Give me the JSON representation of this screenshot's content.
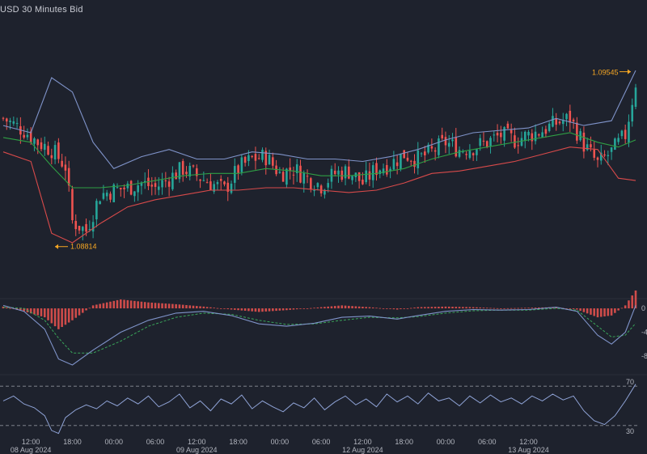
{
  "title": "USD  30 Minutes Bid",
  "colors": {
    "background": "#1e222d",
    "up": "#26a69a",
    "down": "#ef5350",
    "bb_upper": "#7f93c9",
    "bb_middle": "#2f9e44",
    "bb_lower": "#d84a4a",
    "marker": "#f5a623",
    "macd_line": "#7f93c9",
    "signal_line": "#3aa55a",
    "histogram": "#ef5350",
    "rsi_line": "#8fa3d6",
    "level_line": "#8c8f99",
    "axis_text": "#b2b5be"
  },
  "chart_data": [
    {
      "type": "candlestick",
      "name": "price",
      "ylim": [
        1.086,
        1.0975
      ],
      "max_marker": {
        "label": "1.09545",
        "value": 1.09545
      },
      "min_marker": {
        "label": "1.08814",
        "value": 1.08814
      },
      "indicators": [
        "bollinger_upper",
        "bollinger_middle",
        "bollinger_lower"
      ],
      "close_path": [
        [
          0,
          1.0935
        ],
        [
          6,
          1.093
        ],
        [
          10,
          1.0925
        ],
        [
          14,
          1.0922
        ],
        [
          18,
          1.0915
        ],
        [
          20,
          1.0892
        ],
        [
          24,
          1.0888
        ],
        [
          28,
          1.0903
        ],
        [
          32,
          1.0905
        ],
        [
          36,
          1.0906
        ],
        [
          40,
          1.0908
        ],
        [
          44,
          1.0906
        ],
        [
          48,
          1.091
        ],
        [
          52,
          1.0914
        ],
        [
          56,
          1.0911
        ],
        [
          60,
          1.0908
        ],
        [
          64,
          1.0905
        ],
        [
          68,
          1.0914
        ],
        [
          72,
          1.0918
        ],
        [
          76,
          1.0919
        ],
        [
          80,
          1.0912
        ],
        [
          84,
          1.0914
        ],
        [
          88,
          1.091
        ],
        [
          92,
          1.0907
        ],
        [
          96,
          1.0912
        ],
        [
          100,
          1.0913
        ],
        [
          104,
          1.0908
        ],
        [
          108,
          1.0914
        ],
        [
          112,
          1.0916
        ],
        [
          116,
          1.092
        ],
        [
          120,
          1.0918
        ],
        [
          124,
          1.0921
        ],
        [
          128,
          1.0925
        ],
        [
          132,
          1.0922
        ],
        [
          136,
          1.0923
        ],
        [
          140,
          1.0925
        ],
        [
          144,
          1.0928
        ],
        [
          148,
          1.0926
        ],
        [
          152,
          1.0928
        ],
        [
          156,
          1.093
        ],
        [
          160,
          1.0933
        ],
        [
          164,
          1.0935
        ],
        [
          168,
          1.0924
        ],
        [
          172,
          1.0916
        ],
        [
          176,
          1.0921
        ],
        [
          180,
          1.0928
        ],
        [
          183,
          1.095
        ]
      ],
      "bollinger_upper": [
        [
          0,
          1.0932
        ],
        [
          8,
          1.0929
        ],
        [
          14,
          1.0952
        ],
        [
          20,
          1.0946
        ],
        [
          26,
          1.0925
        ],
        [
          32,
          1.0914
        ],
        [
          40,
          1.0919
        ],
        [
          48,
          1.0922
        ],
        [
          56,
          1.0918
        ],
        [
          64,
          1.0918
        ],
        [
          72,
          1.0921
        ],
        [
          80,
          1.092
        ],
        [
          88,
          1.0918
        ],
        [
          96,
          1.0918
        ],
        [
          104,
          1.0917
        ],
        [
          112,
          1.0919
        ],
        [
          120,
          1.0922
        ],
        [
          128,
          1.0926
        ],
        [
          136,
          1.0929
        ],
        [
          144,
          1.093
        ],
        [
          152,
          1.0931
        ],
        [
          160,
          1.0935
        ],
        [
          168,
          1.0932
        ],
        [
          176,
          1.0934
        ],
        [
          183,
          1.0955
        ]
      ],
      "bollinger_middle": [
        [
          0,
          1.0927
        ],
        [
          8,
          1.0925
        ],
        [
          14,
          1.0915
        ],
        [
          20,
          1.0906
        ],
        [
          28,
          1.0906
        ],
        [
          36,
          1.0907
        ],
        [
          44,
          1.0909
        ],
        [
          52,
          1.0911
        ],
        [
          60,
          1.0912
        ],
        [
          68,
          1.0912
        ],
        [
          76,
          1.0914
        ],
        [
          84,
          1.0913
        ],
        [
          92,
          1.0911
        ],
        [
          100,
          1.0911
        ],
        [
          108,
          1.0912
        ],
        [
          116,
          1.0914
        ],
        [
          124,
          1.0918
        ],
        [
          132,
          1.0921
        ],
        [
          140,
          1.0923
        ],
        [
          148,
          1.0925
        ],
        [
          156,
          1.0927
        ],
        [
          164,
          1.0929
        ],
        [
          172,
          1.0925
        ],
        [
          178,
          1.0923
        ],
        [
          183,
          1.0926
        ]
      ],
      "bollinger_lower": [
        [
          0,
          1.0921
        ],
        [
          8,
          1.0917
        ],
        [
          14,
          1.0887
        ],
        [
          20,
          1.0883
        ],
        [
          28,
          1.0891
        ],
        [
          36,
          1.0898
        ],
        [
          44,
          1.0901
        ],
        [
          52,
          1.0903
        ],
        [
          60,
          1.0905
        ],
        [
          68,
          1.0905
        ],
        [
          76,
          1.0906
        ],
        [
          84,
          1.0906
        ],
        [
          92,
          1.0905
        ],
        [
          100,
          1.0904
        ],
        [
          108,
          1.0905
        ],
        [
          116,
          1.0908
        ],
        [
          124,
          1.0912
        ],
        [
          132,
          1.0913
        ],
        [
          140,
          1.0915
        ],
        [
          148,
          1.0917
        ],
        [
          156,
          1.092
        ],
        [
          164,
          1.0923
        ],
        [
          172,
          1.0922
        ],
        [
          178,
          1.091
        ],
        [
          183,
          1.0909
        ]
      ]
    },
    {
      "type": "macd",
      "name": "macd",
      "tick_labels": [
        "0",
        "-4",
        "-8"
      ],
      "tick_values": [
        0,
        -4,
        -8
      ],
      "ylim": [
        -11,
        1.5
      ],
      "macd_line": [
        [
          0,
          0.5
        ],
        [
          6,
          -0.5
        ],
        [
          12,
          -3.5
        ],
        [
          16,
          -8.5
        ],
        [
          20,
          -9.5
        ],
        [
          26,
          -7
        ],
        [
          34,
          -4
        ],
        [
          42,
          -2
        ],
        [
          50,
          -0.8
        ],
        [
          58,
          -0.5
        ],
        [
          66,
          -1.2
        ],
        [
          74,
          -2.6
        ],
        [
          82,
          -3
        ],
        [
          90,
          -2.5
        ],
        [
          98,
          -1.5
        ],
        [
          106,
          -1.3
        ],
        [
          114,
          -1.8
        ],
        [
          120,
          -1.2
        ],
        [
          128,
          -0.5
        ],
        [
          136,
          -0.2
        ],
        [
          144,
          -0.3
        ],
        [
          152,
          -0.2
        ],
        [
          160,
          0.2
        ],
        [
          166,
          -0.5
        ],
        [
          172,
          -4.5
        ],
        [
          176,
          -6
        ],
        [
          180,
          -4
        ],
        [
          183,
          0.5
        ]
      ],
      "signal_line": [
        [
          0,
          0.2
        ],
        [
          6,
          0
        ],
        [
          12,
          -2
        ],
        [
          16,
          -5
        ],
        [
          20,
          -7.5
        ],
        [
          26,
          -7.5
        ],
        [
          34,
          -5.5
        ],
        [
          42,
          -3
        ],
        [
          50,
          -1.5
        ],
        [
          58,
          -0.8
        ],
        [
          66,
          -1
        ],
        [
          74,
          -2
        ],
        [
          82,
          -2.7
        ],
        [
          90,
          -2.6
        ],
        [
          98,
          -2
        ],
        [
          106,
          -1.5
        ],
        [
          114,
          -1.6
        ],
        [
          120,
          -1.4
        ],
        [
          128,
          -0.8
        ],
        [
          136,
          -0.4
        ],
        [
          144,
          -0.3
        ],
        [
          152,
          -0.3
        ],
        [
          160,
          0
        ],
        [
          166,
          -0.3
        ],
        [
          172,
          -3
        ],
        [
          176,
          -4.8
        ],
        [
          180,
          -4.5
        ],
        [
          183,
          -2.5
        ]
      ]
    },
    {
      "type": "line",
      "name": "rsi",
      "tick_labels": [
        "70",
        "30"
      ],
      "levels": [
        70,
        30
      ],
      "ylim": [
        20,
        80
      ],
      "values": [
        [
          0,
          55
        ],
        [
          3,
          60
        ],
        [
          6,
          52
        ],
        [
          9,
          48
        ],
        [
          12,
          40
        ],
        [
          14,
          25
        ],
        [
          16,
          22
        ],
        [
          18,
          38
        ],
        [
          21,
          46
        ],
        [
          24,
          51
        ],
        [
          27,
          47
        ],
        [
          30,
          55
        ],
        [
          33,
          50
        ],
        [
          36,
          58
        ],
        [
          39,
          52
        ],
        [
          42,
          60
        ],
        [
          45,
          49
        ],
        [
          48,
          54
        ],
        [
          51,
          62
        ],
        [
          54,
          48
        ],
        [
          57,
          55
        ],
        [
          60,
          45
        ],
        [
          63,
          57
        ],
        [
          66,
          52
        ],
        [
          69,
          61
        ],
        [
          72,
          47
        ],
        [
          75,
          55
        ],
        [
          78,
          49
        ],
        [
          81,
          44
        ],
        [
          84,
          53
        ],
        [
          87,
          48
        ],
        [
          90,
          58
        ],
        [
          93,
          46
        ],
        [
          96,
          54
        ],
        [
          99,
          60
        ],
        [
          102,
          51
        ],
        [
          105,
          57
        ],
        [
          108,
          49
        ],
        [
          111,
          62
        ],
        [
          114,
          54
        ],
        [
          117,
          60
        ],
        [
          120,
          52
        ],
        [
          123,
          63
        ],
        [
          126,
          55
        ],
        [
          129,
          58
        ],
        [
          132,
          50
        ],
        [
          135,
          60
        ],
        [
          138,
          53
        ],
        [
          141,
          61
        ],
        [
          144,
          54
        ],
        [
          147,
          58
        ],
        [
          150,
          52
        ],
        [
          153,
          60
        ],
        [
          156,
          55
        ],
        [
          159,
          62
        ],
        [
          162,
          56
        ],
        [
          165,
          60
        ],
        [
          168,
          45
        ],
        [
          171,
          35
        ],
        [
          174,
          31
        ],
        [
          177,
          40
        ],
        [
          180,
          55
        ],
        [
          183,
          72
        ]
      ]
    }
  ],
  "x_axis": {
    "total_bars": 184,
    "time_ticks": [
      {
        "label": "12:00",
        "bar": 8
      },
      {
        "label": "18:00",
        "bar": 20
      },
      {
        "label": "00:00",
        "bar": 32
      },
      {
        "label": "06:00",
        "bar": 44
      },
      {
        "label": "12:00",
        "bar": 56
      },
      {
        "label": "18:00",
        "bar": 68
      },
      {
        "label": "00:00",
        "bar": 80
      },
      {
        "label": "06:00",
        "bar": 92
      },
      {
        "label": "12:00",
        "bar": 104
      },
      {
        "label": "18:00",
        "bar": 116
      },
      {
        "label": "00:00",
        "bar": 128
      },
      {
        "label": "06:00",
        "bar": 140
      },
      {
        "label": "12:00",
        "bar": 152
      }
    ],
    "date_ticks": [
      {
        "label": "08 Aug 2024",
        "bar": 8
      },
      {
        "label": "09 Aug 2024",
        "bar": 56
      },
      {
        "label": "12 Aug 2024",
        "bar": 104
      },
      {
        "label": "13 Aug 2024",
        "bar": 152
      }
    ]
  }
}
